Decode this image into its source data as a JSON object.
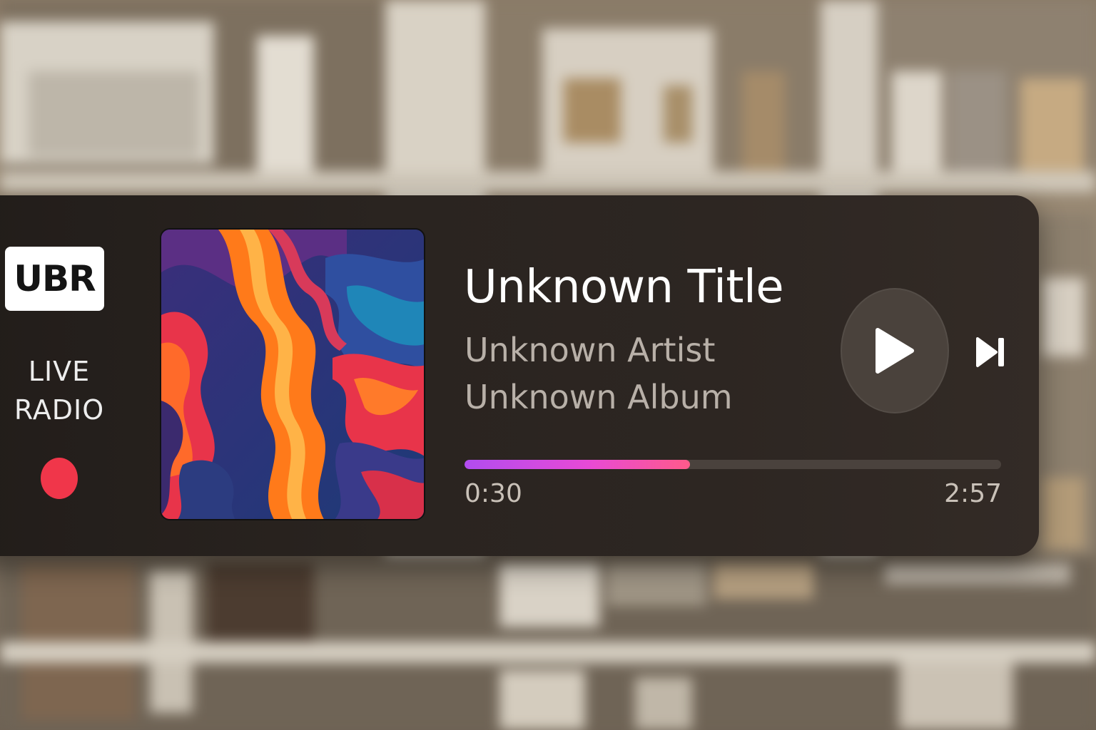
{
  "station": {
    "logo_text": "UBR",
    "live_line1": "LIVE",
    "live_line2": "RADIO",
    "live_indicator_color": "#f0364a"
  },
  "track": {
    "title": "Unknown Title",
    "artist": "Unknown Artist",
    "album": "Unknown Album",
    "artwork_icon": "abstract-swirl-artwork"
  },
  "controls": {
    "play_icon": "play-icon",
    "next_icon": "skip-next-icon"
  },
  "progress": {
    "elapsed": "0:30",
    "total": "2:57",
    "fraction": 0.42,
    "gradient_colors": [
      "#b14cf0",
      "#e84ad6",
      "#ff5a8a"
    ]
  }
}
